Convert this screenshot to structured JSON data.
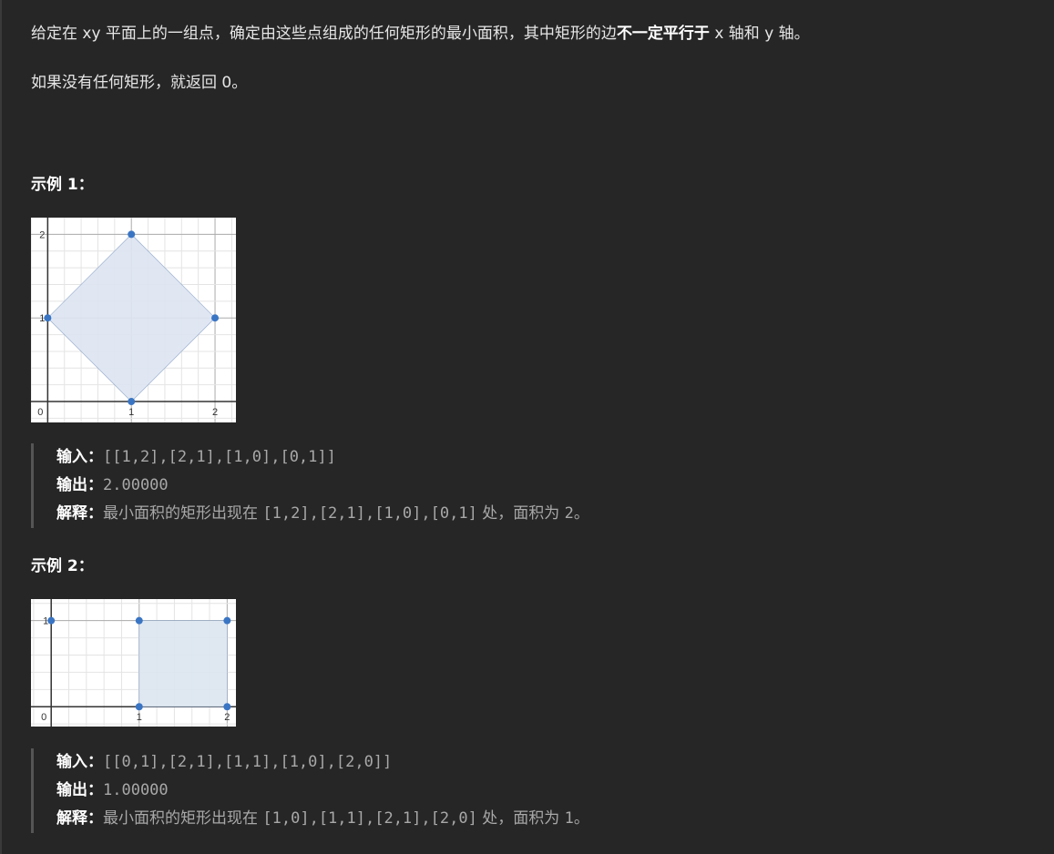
{
  "description": {
    "p1_before": "给定在 xy 平面上的一组点，确定由这些点组成的任何矩形的最小面积，其中矩形的边",
    "p1_bold": "不一定平行于",
    "p1_after": " x 轴和 y 轴。",
    "p2": "如果没有任何矩形，就返回 0。"
  },
  "examples": [
    {
      "title": "示例 1：",
      "input_label": "输入：",
      "input": "[[1,2],[2,1],[1,0],[0,1]]",
      "output_label": "输出：",
      "output": "2.00000",
      "explain_label": "解释：",
      "explain_text": "最小面积的矩形出现在 ",
      "explain_points": "[1,2],[2,1],[1,0],[0,1]",
      "explain_suffix": " 处，面积为 ",
      "explain_area": "2",
      "explain_end": "。"
    },
    {
      "title": "示例 2：",
      "input_label": "输入：",
      "input": "[[0,1],[2,1],[1,1],[1,0],[2,0]]",
      "output_label": "输出：",
      "output": "1.00000",
      "explain_label": "解释：",
      "explain_text": "最小面积的矩形出现在 ",
      "explain_points": "[1,0],[1,1],[2,1],[2,0]",
      "explain_suffix": " 处，面积为 ",
      "explain_area": "1",
      "explain_end": "。"
    }
  ],
  "chart_data": [
    {
      "type": "scatter",
      "points": [
        [
          1,
          2
        ],
        [
          2,
          1
        ],
        [
          1,
          0
        ],
        [
          0,
          1
        ]
      ],
      "polygon": [
        [
          1,
          2
        ],
        [
          2,
          1
        ],
        [
          1,
          0
        ],
        [
          0,
          1
        ]
      ],
      "xlim": [
        -0.2,
        2.25
      ],
      "ylim": [
        -0.25,
        2.2
      ],
      "xticks": [
        "0",
        "1",
        "2"
      ],
      "yticks": [
        "1",
        "2"
      ],
      "grid": true,
      "point_color": "#3a75c4",
      "fill_color": "#dde4f2"
    },
    {
      "type": "scatter",
      "points": [
        [
          0,
          1
        ],
        [
          2,
          1
        ],
        [
          1,
          1
        ],
        [
          1,
          0
        ],
        [
          2,
          0
        ]
      ],
      "polygon": [
        [
          1,
          0
        ],
        [
          1,
          1
        ],
        [
          2,
          1
        ],
        [
          2,
          0
        ]
      ],
      "xlim": [
        -0.23,
        2.1
      ],
      "ylim": [
        -0.23,
        1.25
      ],
      "xticks": [
        "0",
        "1",
        "2"
      ],
      "yticks": [
        "1"
      ],
      "grid": true,
      "point_color": "#3a75c4",
      "fill_color": "#dce5f0"
    }
  ]
}
